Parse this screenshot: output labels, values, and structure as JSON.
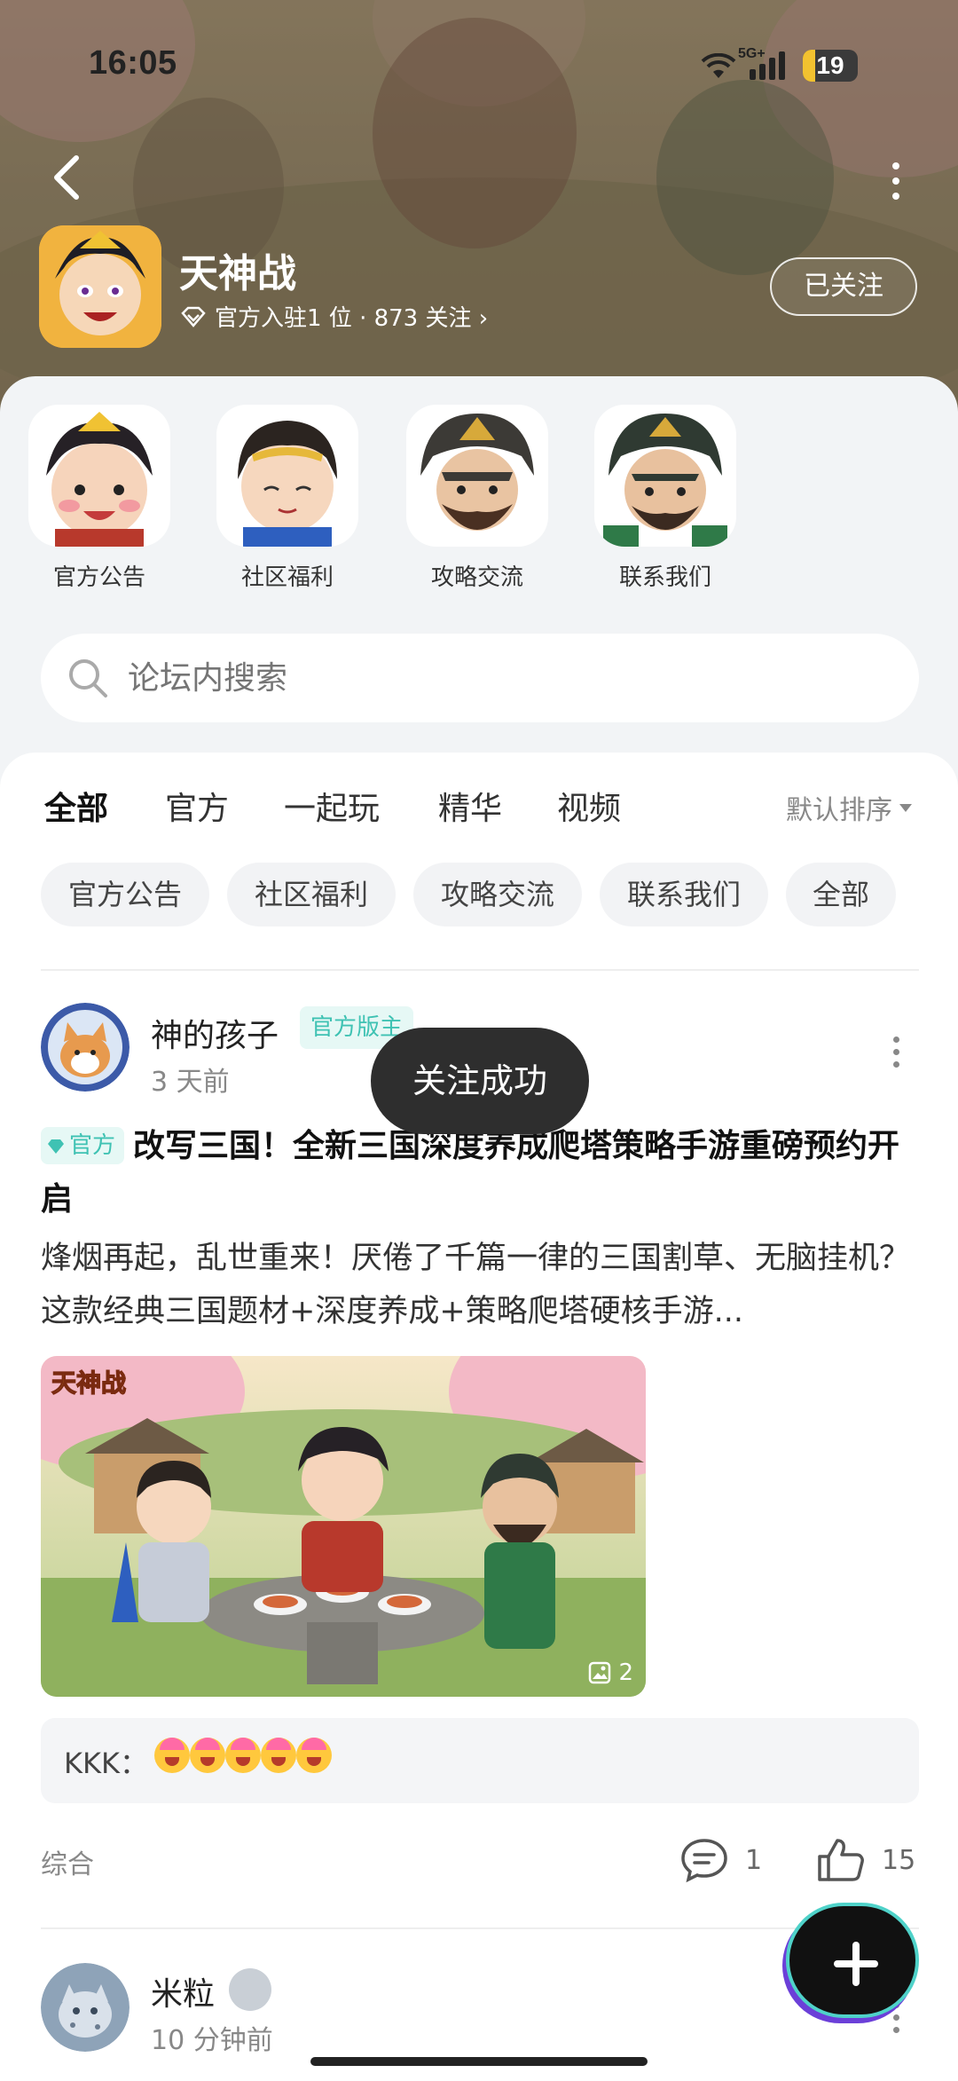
{
  "status_bar": {
    "time": "16:05",
    "network": "5G+",
    "battery": "19"
  },
  "forum": {
    "name": "天神战",
    "meta": "官方入驻1 位 · 873 关注 ›",
    "follow_label": "已关注"
  },
  "shortcuts": [
    {
      "label": "官方公告"
    },
    {
      "label": "社区福利"
    },
    {
      "label": "攻略交流"
    },
    {
      "label": "联系我们"
    }
  ],
  "search": {
    "placeholder": "论坛内搜索"
  },
  "tabs": [
    "全部",
    "官方",
    "一起玩",
    "精华",
    "视频"
  ],
  "sort_label": "默认排序",
  "chips": [
    "官方公告",
    "社区福利",
    "攻略交流",
    "联系我们",
    "全部"
  ],
  "toast": "关注成功",
  "post": {
    "author": "神的孩子",
    "role": "官方版主",
    "time": "3 天前",
    "badge": "官方",
    "title": "改写三国！全新三国深度养成爬塔策略手游重磅预约开启",
    "body": "烽烟再起，乱世重来！厌倦了千篇一律的三国割草、无脑挂机？这款经典三国题材+深度养成+策略爬塔硬核手游...",
    "image_text": "天神战",
    "image_count": "2",
    "comment_author": "KKK：",
    "category": "综合",
    "comments": "1",
    "likes": "15"
  },
  "post2": {
    "author": "米粒",
    "time": "10 分钟前"
  },
  "colors": {
    "accent": "#44d4c8",
    "badge_text": "#3fc2b3",
    "badge_bg": "#e6f8f5"
  }
}
